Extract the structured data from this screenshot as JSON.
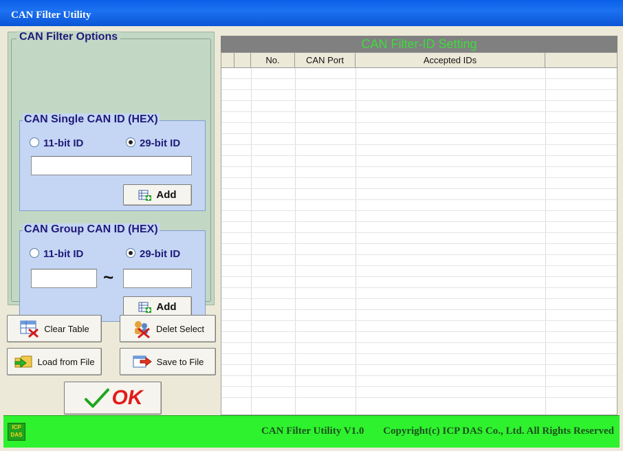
{
  "window": {
    "title": "CAN Filter Utility"
  },
  "options": {
    "title": "CAN Filter Options",
    "single": {
      "title": "CAN Single CAN ID (HEX)",
      "radio_11": "11-bit ID",
      "radio_29": "29-bit ID",
      "selected": "29-bit ID",
      "id_value": "",
      "add_label": "Add"
    },
    "group": {
      "title": "CAN Group CAN ID (HEX)",
      "radio_11": "11-bit ID",
      "radio_29": "29-bit ID",
      "selected": "29-bit ID",
      "from_value": "",
      "tilde": "~",
      "to_value": "",
      "add_label": "Add"
    }
  },
  "actions": {
    "clear_table": "Clear Table",
    "delete_select": "Delet Select",
    "load_file": "Load from File",
    "save_file": "Save to File",
    "ok": "OK"
  },
  "table": {
    "title": "CAN Filter-ID Setting",
    "columns": [
      "",
      "No.",
      "CAN Port",
      "Accepted IDs",
      ""
    ],
    "rows": []
  },
  "footer": {
    "logo": "ICP DAS",
    "app": "CAN Filter Utility  V1.0",
    "copyright": "Copyright(c) ICP DAS Co., Ltd. All Rights Reserved"
  },
  "colors": {
    "title_bar": "#1c72f1",
    "options_bg": "#c3d8c4",
    "group_bg": "#c4d6f3",
    "header_text": "#3cdc3c",
    "footer_bg": "#2ef22e",
    "ok_check": "#1fa51f",
    "ok_text": "#e31a1a"
  }
}
